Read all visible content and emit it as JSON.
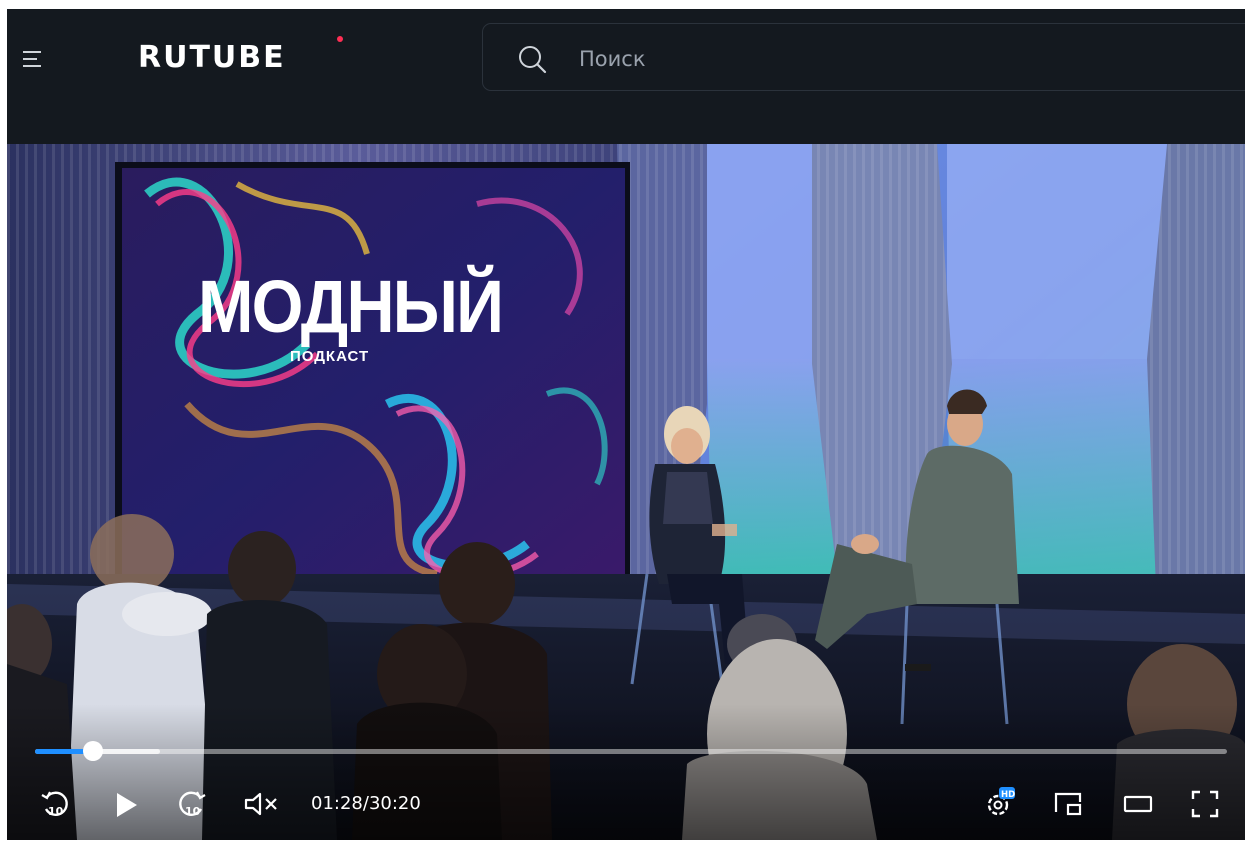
{
  "header": {
    "logo_text": "RUTUBE",
    "search": {
      "placeholder": "Поиск",
      "value": ""
    },
    "icons": {
      "menu": "hamburger-menu-icon",
      "search": "search-icon"
    },
    "brand_dot_color": "#ff2e54"
  },
  "video": {
    "screen_title": "МОДНЫЙ",
    "screen_subtitle": "ПОДКАСТ",
    "progress": {
      "played_fraction": 0.0485,
      "buffered_fraction": 0.105,
      "played_color": "#1f8fff"
    },
    "time": {
      "current": "01:28",
      "separator": "/",
      "duration": "30:20"
    },
    "controls": {
      "rewind_icon": "rewind-10-icon",
      "play_icon": "play-icon",
      "forward_icon": "forward-10-icon",
      "mute_icon": "volume-muted-icon",
      "settings_icon": "settings-hd-icon",
      "settings_badge": "HD",
      "miniplayer_icon": "miniplayer-icon",
      "theater_icon": "theater-mode-icon",
      "fullscreen_icon": "fullscreen-icon"
    }
  }
}
